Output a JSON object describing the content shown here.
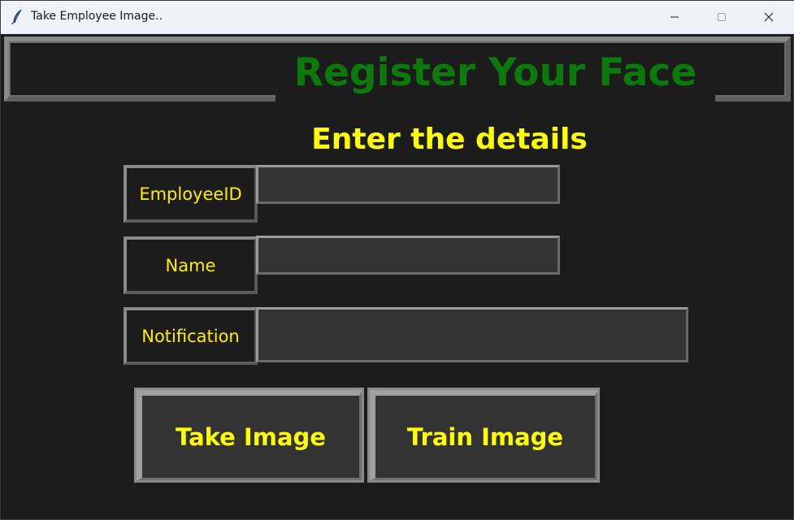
{
  "window": {
    "title": "Take Employee Image.."
  },
  "header": {
    "title": "Register Your Face"
  },
  "form": {
    "subtitle": "Enter the details",
    "employee_id_label": "EmployeeID",
    "employee_id_value": "",
    "name_label": "Name",
    "name_value": "",
    "notification_label": "Notification",
    "notification_value": ""
  },
  "actions": {
    "take_image_label": "Take Image",
    "train_image_label": "Train Image"
  },
  "colors": {
    "background": "#1c1c1c",
    "header_text": "#0b7a0b",
    "accent_text": "#ffff00",
    "field_bg": "#333333"
  },
  "icons": {
    "app": "feather-icon",
    "minimize": "minimize-icon",
    "maximize": "maximize-icon",
    "close": "close-icon"
  }
}
